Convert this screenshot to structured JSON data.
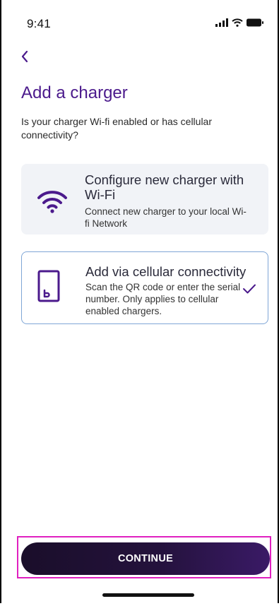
{
  "status_bar": {
    "time": "9:41"
  },
  "header": {
    "title": "Add a charger"
  },
  "subtitle": "Is your charger Wi-fi enabled or has cellular connectivity?",
  "options": [
    {
      "title": "Configure new charger with Wi-Fi",
      "description": "Connect new charger to your local Wi-fi Network",
      "icon": "wifi-icon",
      "selected": false
    },
    {
      "title": "Add via cellular connectivity",
      "description": "Scan the QR code or enter the serial number. Only applies to cellular enabled chargers.",
      "icon": "phone-icon",
      "selected": true
    }
  ],
  "actions": {
    "continue_label": "CONTINUE"
  },
  "colors": {
    "accent": "#4b1a8c",
    "selected_border": "#7fa6d6",
    "card_bg": "#f1f3f7"
  }
}
